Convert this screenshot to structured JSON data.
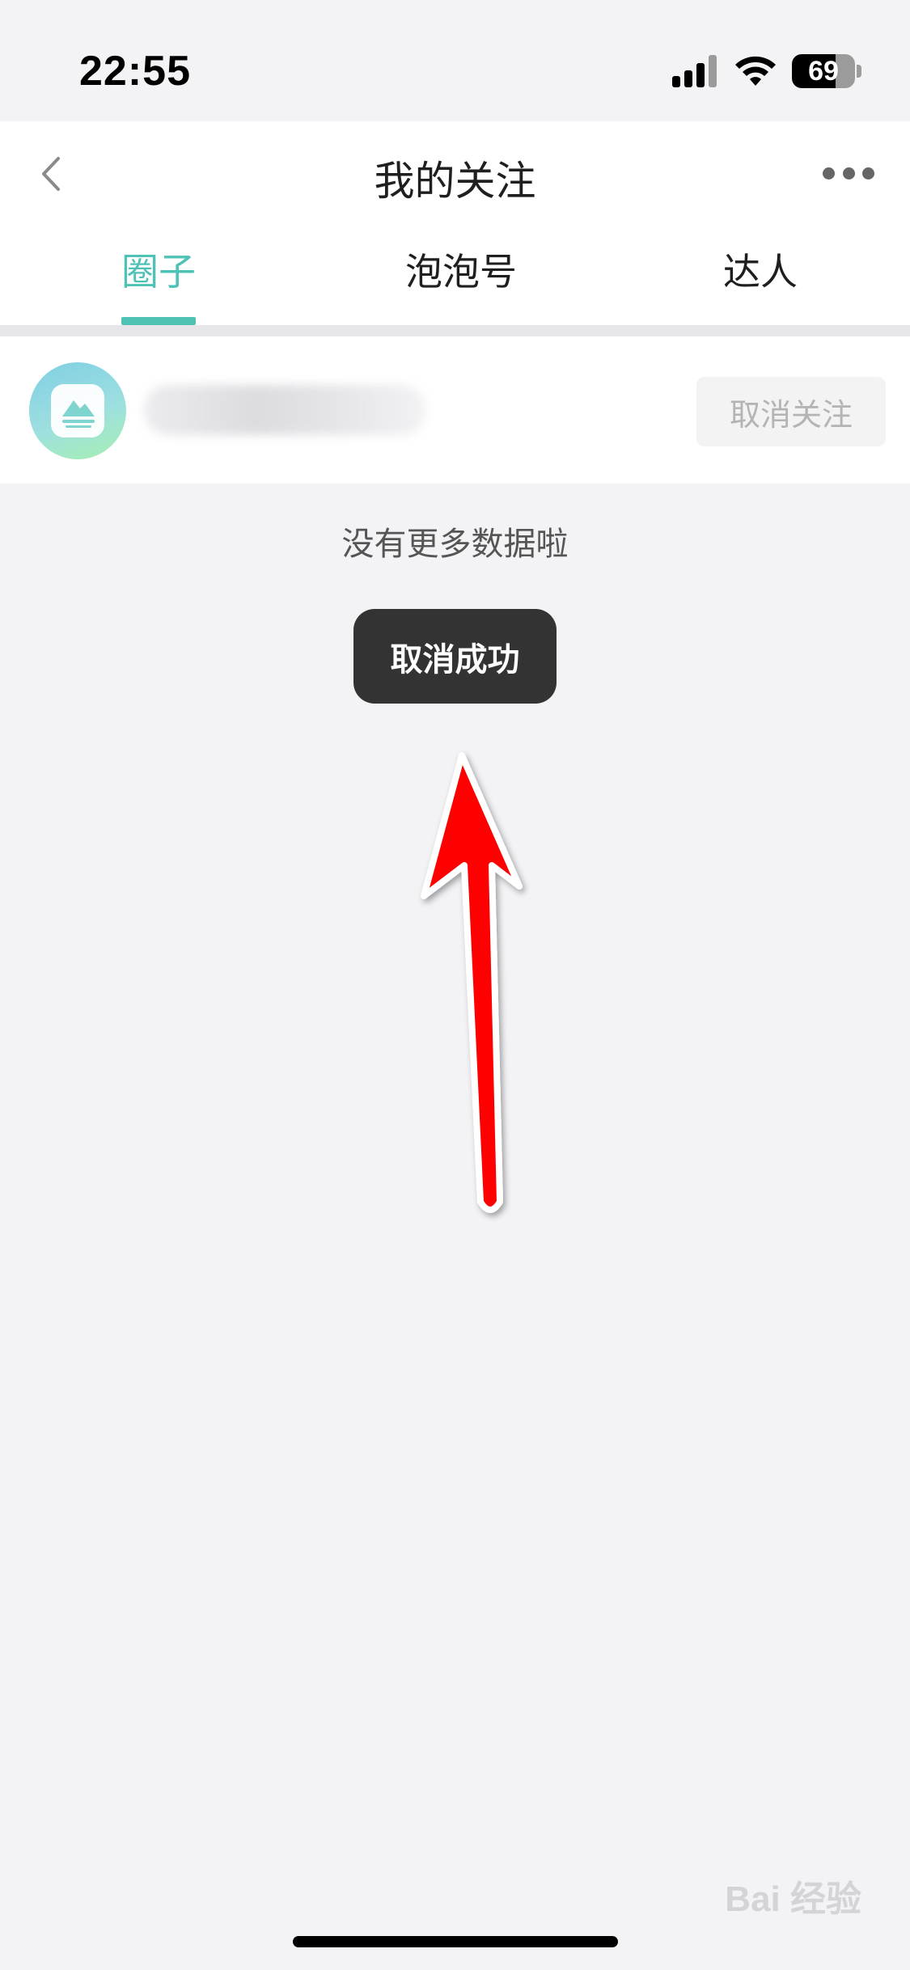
{
  "status_bar": {
    "time": "22:55",
    "battery": "69",
    "battery_level": 0.69
  },
  "header": {
    "title": "我的关注",
    "back_icon": "chevron-left-icon",
    "more_icon": "more-horizontal-icon"
  },
  "tabs": [
    {
      "label": "圈子",
      "active": true
    },
    {
      "label": "泡泡号",
      "active": false
    },
    {
      "label": "达人",
      "active": false
    }
  ],
  "list": {
    "items": [
      {
        "avatar_icon": "landscape-icon",
        "unfollow_label": "取消关注"
      }
    ],
    "end_text": "没有更多数据啦"
  },
  "toast": {
    "text": "取消成功"
  },
  "watermark": {
    "text": "Bai 经验"
  },
  "colors": {
    "accent": "#4fc2b6",
    "background": "#f3f3f6",
    "toast_bg": "#333333",
    "annotation_arrow": "#ff0000"
  }
}
